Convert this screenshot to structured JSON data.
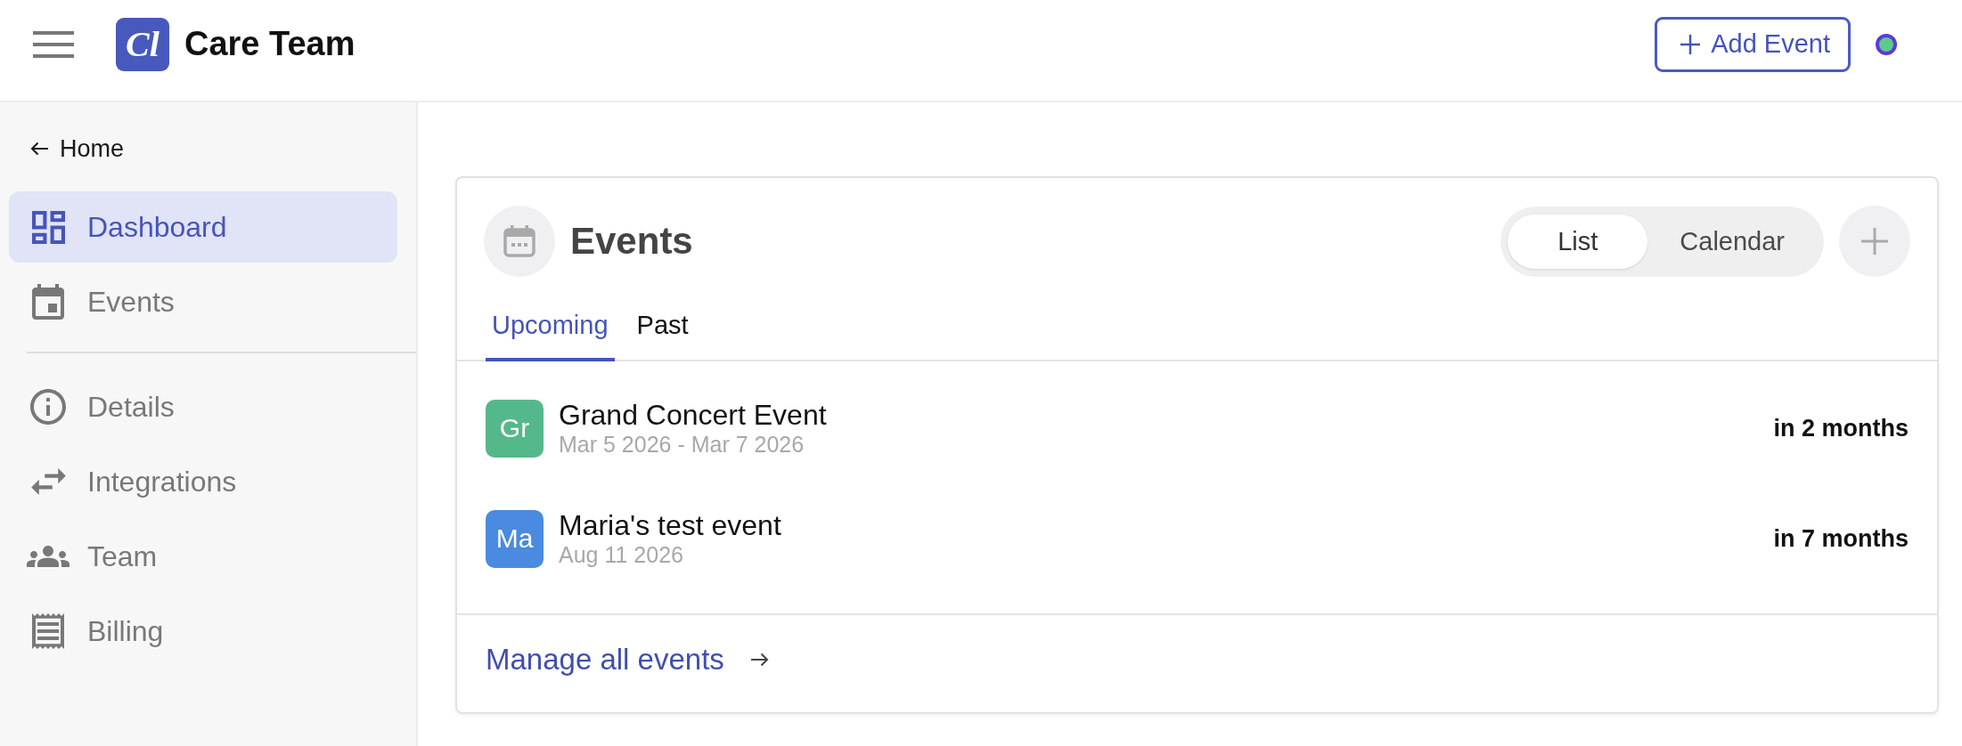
{
  "header": {
    "logo_text": "Cl",
    "title": "Care Team",
    "add_button": "Add Event"
  },
  "sidebar": {
    "back_link": "Home",
    "sections": [
      {
        "items": [
          {
            "label": "Dashboard",
            "selected": true
          },
          {
            "label": "Events",
            "selected": false
          }
        ]
      },
      {
        "items": [
          {
            "label": "Details",
            "selected": false
          },
          {
            "label": "Integrations",
            "selected": false
          },
          {
            "label": "Team",
            "selected": false
          },
          {
            "label": "Billing",
            "selected": false
          }
        ]
      }
    ]
  },
  "events_card": {
    "title": "Events",
    "view_toggle": [
      {
        "label": "List",
        "selected": true
      },
      {
        "label": "Calendar",
        "selected": false
      }
    ],
    "tabs": [
      {
        "label": "Upcoming",
        "selected": true
      },
      {
        "label": "Past",
        "selected": false
      }
    ],
    "events": [
      {
        "initials": "Gr",
        "color": "#55b88a",
        "name": "Grand Concert Event",
        "dates": "Mar 5 2026 - Mar 7 2026",
        "relative": "in 2 months"
      },
      {
        "initials": "Ma",
        "color": "#4a8ae0",
        "name": "Maria's test event",
        "dates": "Aug 11 2026",
        "relative": "in 7 months"
      }
    ],
    "footer_link": "Manage all events"
  }
}
